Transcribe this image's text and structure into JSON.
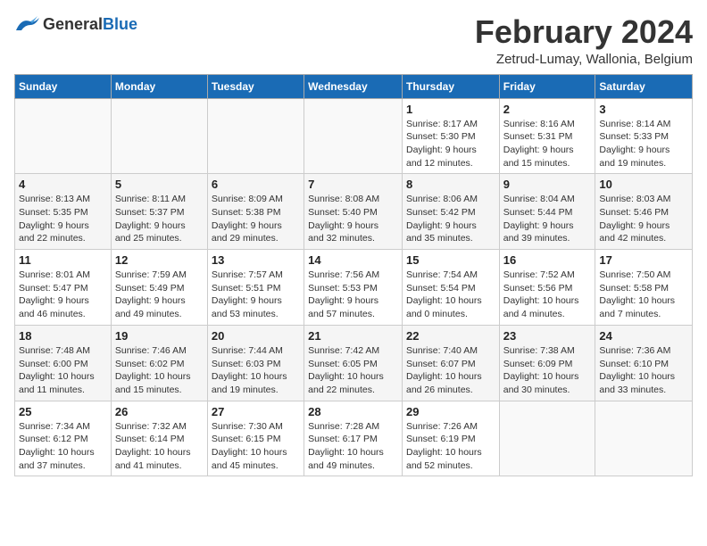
{
  "header": {
    "logo_general": "General",
    "logo_blue": "Blue",
    "title": "February 2024",
    "subtitle": "Zetrud-Lumay, Wallonia, Belgium"
  },
  "days_of_week": [
    "Sunday",
    "Monday",
    "Tuesday",
    "Wednesday",
    "Thursday",
    "Friday",
    "Saturday"
  ],
  "weeks": [
    [
      {
        "day": "",
        "info": ""
      },
      {
        "day": "",
        "info": ""
      },
      {
        "day": "",
        "info": ""
      },
      {
        "day": "",
        "info": ""
      },
      {
        "day": "1",
        "info": "Sunrise: 8:17 AM\nSunset: 5:30 PM\nDaylight: 9 hours\nand 12 minutes."
      },
      {
        "day": "2",
        "info": "Sunrise: 8:16 AM\nSunset: 5:31 PM\nDaylight: 9 hours\nand 15 minutes."
      },
      {
        "day": "3",
        "info": "Sunrise: 8:14 AM\nSunset: 5:33 PM\nDaylight: 9 hours\nand 19 minutes."
      }
    ],
    [
      {
        "day": "4",
        "info": "Sunrise: 8:13 AM\nSunset: 5:35 PM\nDaylight: 9 hours\nand 22 minutes."
      },
      {
        "day": "5",
        "info": "Sunrise: 8:11 AM\nSunset: 5:37 PM\nDaylight: 9 hours\nand 25 minutes."
      },
      {
        "day": "6",
        "info": "Sunrise: 8:09 AM\nSunset: 5:38 PM\nDaylight: 9 hours\nand 29 minutes."
      },
      {
        "day": "7",
        "info": "Sunrise: 8:08 AM\nSunset: 5:40 PM\nDaylight: 9 hours\nand 32 minutes."
      },
      {
        "day": "8",
        "info": "Sunrise: 8:06 AM\nSunset: 5:42 PM\nDaylight: 9 hours\nand 35 minutes."
      },
      {
        "day": "9",
        "info": "Sunrise: 8:04 AM\nSunset: 5:44 PM\nDaylight: 9 hours\nand 39 minutes."
      },
      {
        "day": "10",
        "info": "Sunrise: 8:03 AM\nSunset: 5:46 PM\nDaylight: 9 hours\nand 42 minutes."
      }
    ],
    [
      {
        "day": "11",
        "info": "Sunrise: 8:01 AM\nSunset: 5:47 PM\nDaylight: 9 hours\nand 46 minutes."
      },
      {
        "day": "12",
        "info": "Sunrise: 7:59 AM\nSunset: 5:49 PM\nDaylight: 9 hours\nand 49 minutes."
      },
      {
        "day": "13",
        "info": "Sunrise: 7:57 AM\nSunset: 5:51 PM\nDaylight: 9 hours\nand 53 minutes."
      },
      {
        "day": "14",
        "info": "Sunrise: 7:56 AM\nSunset: 5:53 PM\nDaylight: 9 hours\nand 57 minutes."
      },
      {
        "day": "15",
        "info": "Sunrise: 7:54 AM\nSunset: 5:54 PM\nDaylight: 10 hours\nand 0 minutes."
      },
      {
        "day": "16",
        "info": "Sunrise: 7:52 AM\nSunset: 5:56 PM\nDaylight: 10 hours\nand 4 minutes."
      },
      {
        "day": "17",
        "info": "Sunrise: 7:50 AM\nSunset: 5:58 PM\nDaylight: 10 hours\nand 7 minutes."
      }
    ],
    [
      {
        "day": "18",
        "info": "Sunrise: 7:48 AM\nSunset: 6:00 PM\nDaylight: 10 hours\nand 11 minutes."
      },
      {
        "day": "19",
        "info": "Sunrise: 7:46 AM\nSunset: 6:02 PM\nDaylight: 10 hours\nand 15 minutes."
      },
      {
        "day": "20",
        "info": "Sunrise: 7:44 AM\nSunset: 6:03 PM\nDaylight: 10 hours\nand 19 minutes."
      },
      {
        "day": "21",
        "info": "Sunrise: 7:42 AM\nSunset: 6:05 PM\nDaylight: 10 hours\nand 22 minutes."
      },
      {
        "day": "22",
        "info": "Sunrise: 7:40 AM\nSunset: 6:07 PM\nDaylight: 10 hours\nand 26 minutes."
      },
      {
        "day": "23",
        "info": "Sunrise: 7:38 AM\nSunset: 6:09 PM\nDaylight: 10 hours\nand 30 minutes."
      },
      {
        "day": "24",
        "info": "Sunrise: 7:36 AM\nSunset: 6:10 PM\nDaylight: 10 hours\nand 33 minutes."
      }
    ],
    [
      {
        "day": "25",
        "info": "Sunrise: 7:34 AM\nSunset: 6:12 PM\nDaylight: 10 hours\nand 37 minutes."
      },
      {
        "day": "26",
        "info": "Sunrise: 7:32 AM\nSunset: 6:14 PM\nDaylight: 10 hours\nand 41 minutes."
      },
      {
        "day": "27",
        "info": "Sunrise: 7:30 AM\nSunset: 6:15 PM\nDaylight: 10 hours\nand 45 minutes."
      },
      {
        "day": "28",
        "info": "Sunrise: 7:28 AM\nSunset: 6:17 PM\nDaylight: 10 hours\nand 49 minutes."
      },
      {
        "day": "29",
        "info": "Sunrise: 7:26 AM\nSunset: 6:19 PM\nDaylight: 10 hours\nand 52 minutes."
      },
      {
        "day": "",
        "info": ""
      },
      {
        "day": "",
        "info": ""
      }
    ]
  ]
}
